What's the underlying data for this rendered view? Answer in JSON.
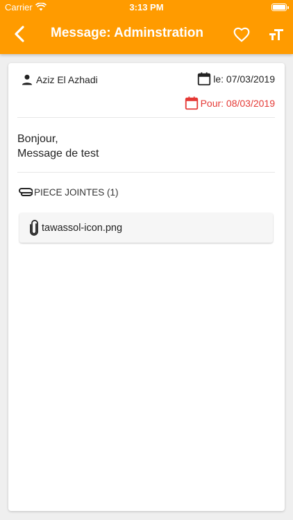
{
  "status_bar": {
    "carrier": "Carrier",
    "time": "3:13 PM"
  },
  "nav": {
    "title": "Message: Adminstration",
    "back_icon": "chevron-left-icon",
    "favorite_icon": "heart-outline-icon",
    "font_size_icon": "format-size-icon"
  },
  "message": {
    "author": "Aziz El Azhadi",
    "date_label": "le: 07/03/2019",
    "due_label": "Pour: 08/03/2019",
    "body_line1": "Bonjour,",
    "body_line2": "Message de test"
  },
  "attachments": {
    "header": "PIECE JOINTES (1)",
    "items": [
      {
        "name": "tawassol-icon.png"
      }
    ]
  },
  "colors": {
    "accent": "#ff9b00",
    "due": "#e53935"
  }
}
